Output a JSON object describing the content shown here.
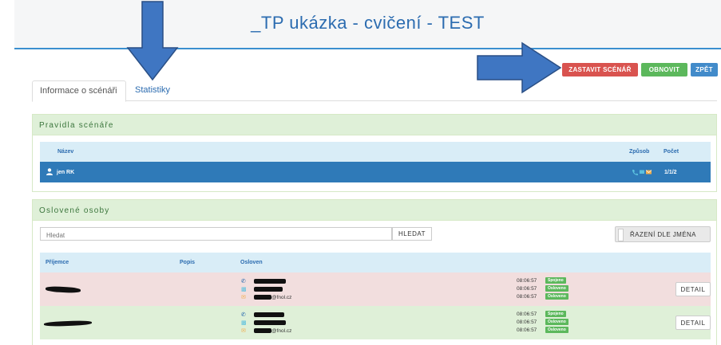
{
  "header": {
    "title": "_TP ukázka - cvičení - TEST"
  },
  "toolbar": {
    "stop_label": "ZASTAVIT SCÉNÁŘ",
    "refresh_label": "OBNOVIT",
    "back_label": "ZPĚT"
  },
  "tabs": [
    {
      "label": "Informace o scénáři",
      "active": true
    },
    {
      "label": "Statistiky",
      "active": false
    }
  ],
  "rules": {
    "title": "Pravidla scénáře",
    "columns": {
      "name": "Název",
      "method": "Způsob",
      "count": "Počet"
    },
    "rows": [
      {
        "name": "jen RK",
        "count": "1/1/2"
      }
    ]
  },
  "persons": {
    "title": "Oslovené osoby",
    "search": {
      "placeholder": "Hledat",
      "button": "HLEDAT"
    },
    "sort_label": "ŘAZENÍ DLE JMÉNA",
    "columns": {
      "recipient": "Příjemce",
      "description": "Popis",
      "contacted": "Osloven"
    },
    "rows": [
      {
        "email_suffix": "@fnol.cz",
        "statuses": [
          {
            "time": "08:06:57",
            "badge": "Spojeno"
          },
          {
            "time": "08:06:57",
            "badge": "Osloveno"
          },
          {
            "time": "08:06:57",
            "badge": "Osloveno"
          }
        ],
        "detail_label": "DETAIL",
        "row_color": "#f2dede"
      },
      {
        "email_suffix": "@fnol.cz",
        "statuses": [
          {
            "time": "08:06:57",
            "badge": "Spojeno"
          },
          {
            "time": "08:06:57",
            "badge": "Osloveno"
          },
          {
            "time": "08:06:57",
            "badge": "Osloveno"
          }
        ],
        "detail_label": "DETAIL",
        "row_color": "#dff0d8"
      }
    ]
  },
  "colors": {
    "brand": "#2c6cb0",
    "danger": "#d9534f",
    "success": "#5cb85c",
    "primary": "#428bca",
    "arrow": "#3f76c2"
  }
}
